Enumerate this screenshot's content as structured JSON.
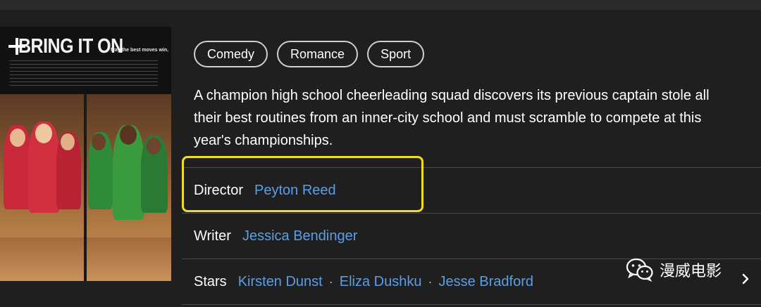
{
  "movie": {
    "poster": {
      "title": "BRING IT ON",
      "tagline": "May the best moves win."
    },
    "genres": [
      "Comedy",
      "Romance",
      "Sport"
    ],
    "plot": "A champion high school cheerleading squad discovers its previous captain stole all their best routines from an inner-city school and must scramble to compete at this year's championships.",
    "credits": {
      "director": {
        "label": "Director",
        "names": [
          "Peyton Reed"
        ]
      },
      "writer": {
        "label": "Writer",
        "names": [
          "Jessica Bendinger"
        ]
      },
      "stars": {
        "label": "Stars",
        "names": [
          "Kirsten Dunst",
          "Eliza Dushku",
          "Jesse Bradford"
        ],
        "separator": "·"
      }
    }
  },
  "watermark": {
    "text": "漫威电影"
  },
  "colors": {
    "background": "#1f1f1f",
    "link": "#5c9ee6",
    "highlight": "#f2dc1e",
    "chip_border": "#cfcfcf"
  }
}
